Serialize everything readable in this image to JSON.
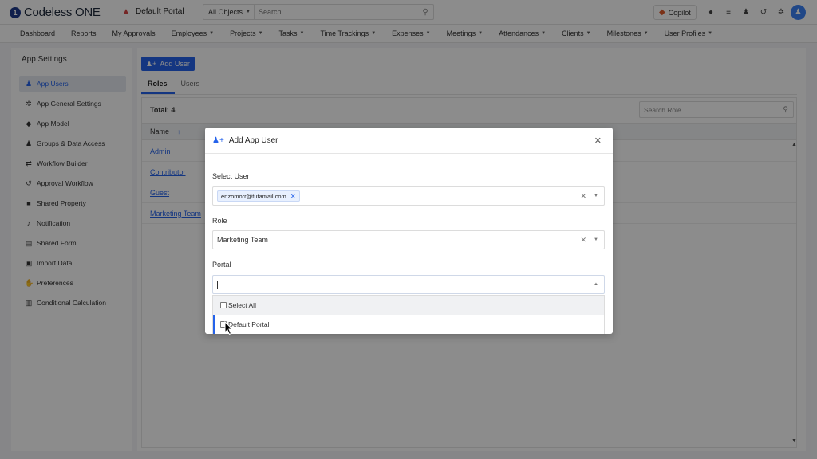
{
  "brand": {
    "name": "Codeless ONE",
    "logo_letter": "1"
  },
  "portal": {
    "name": "Default Portal"
  },
  "search": {
    "scope": "All Objects",
    "placeholder": "Search"
  },
  "copilot": {
    "label": "Copilot"
  },
  "top_icons": [
    "help-icon",
    "database-icon",
    "user-add-icon",
    "history-icon",
    "gear-icon"
  ],
  "nav": [
    {
      "label": "Dashboard",
      "caret": false
    },
    {
      "label": "Reports",
      "caret": false
    },
    {
      "label": "My Approvals",
      "caret": false
    },
    {
      "label": "Employees",
      "caret": true
    },
    {
      "label": "Projects",
      "caret": true
    },
    {
      "label": "Tasks",
      "caret": true
    },
    {
      "label": "Time Trackings",
      "caret": true
    },
    {
      "label": "Expenses",
      "caret": true
    },
    {
      "label": "Meetings",
      "caret": true
    },
    {
      "label": "Attendances",
      "caret": true
    },
    {
      "label": "Clients",
      "caret": true
    },
    {
      "label": "Milestones",
      "caret": true
    },
    {
      "label": "User Profiles",
      "caret": true
    }
  ],
  "sidebar": {
    "title": "App Settings",
    "items": [
      {
        "label": "App Users",
        "icon": "users-icon",
        "active": true
      },
      {
        "label": "App General Settings",
        "icon": "gear-icon",
        "active": false
      },
      {
        "label": "App Model",
        "icon": "cube-icon",
        "active": false
      },
      {
        "label": "Groups & Data Access",
        "icon": "group-icon",
        "active": false
      },
      {
        "label": "Workflow Builder",
        "icon": "workflow-icon",
        "active": false
      },
      {
        "label": "Approval Workflow",
        "icon": "approval-icon",
        "active": false
      },
      {
        "label": "Shared Property",
        "icon": "shared-property-icon",
        "active": false
      },
      {
        "label": "Notification",
        "icon": "bell-icon",
        "active": false
      },
      {
        "label": "Shared Form",
        "icon": "form-icon",
        "active": false
      },
      {
        "label": "Import Data",
        "icon": "import-icon",
        "active": false
      },
      {
        "label": "Preferences",
        "icon": "preferences-icon",
        "active": false
      },
      {
        "label": "Conditional Calculation",
        "icon": "calculator-icon",
        "active": false
      }
    ]
  },
  "main": {
    "add_user_label": "Add User",
    "tabs": [
      {
        "label": "Roles",
        "active": true
      },
      {
        "label": "Users",
        "active": false
      }
    ],
    "total_label": "Total: 4",
    "search_placeholder": "Search Role",
    "column_name": "Name",
    "roles": [
      "Admin",
      "Contributor",
      "Guest",
      "Marketing Team"
    ]
  },
  "modal": {
    "title": "Add App User",
    "select_user_label": "Select User",
    "selected_user": "enzomorr@tutamail.com",
    "role_label": "Role",
    "role_value": "Marketing Team",
    "portal_label": "Portal",
    "portal_options": [
      "Select All",
      "Default Portal"
    ]
  },
  "colors": {
    "accent": "#2563eb",
    "brand_dark": "#1e3a8a",
    "portal_icon": "#d64545"
  }
}
